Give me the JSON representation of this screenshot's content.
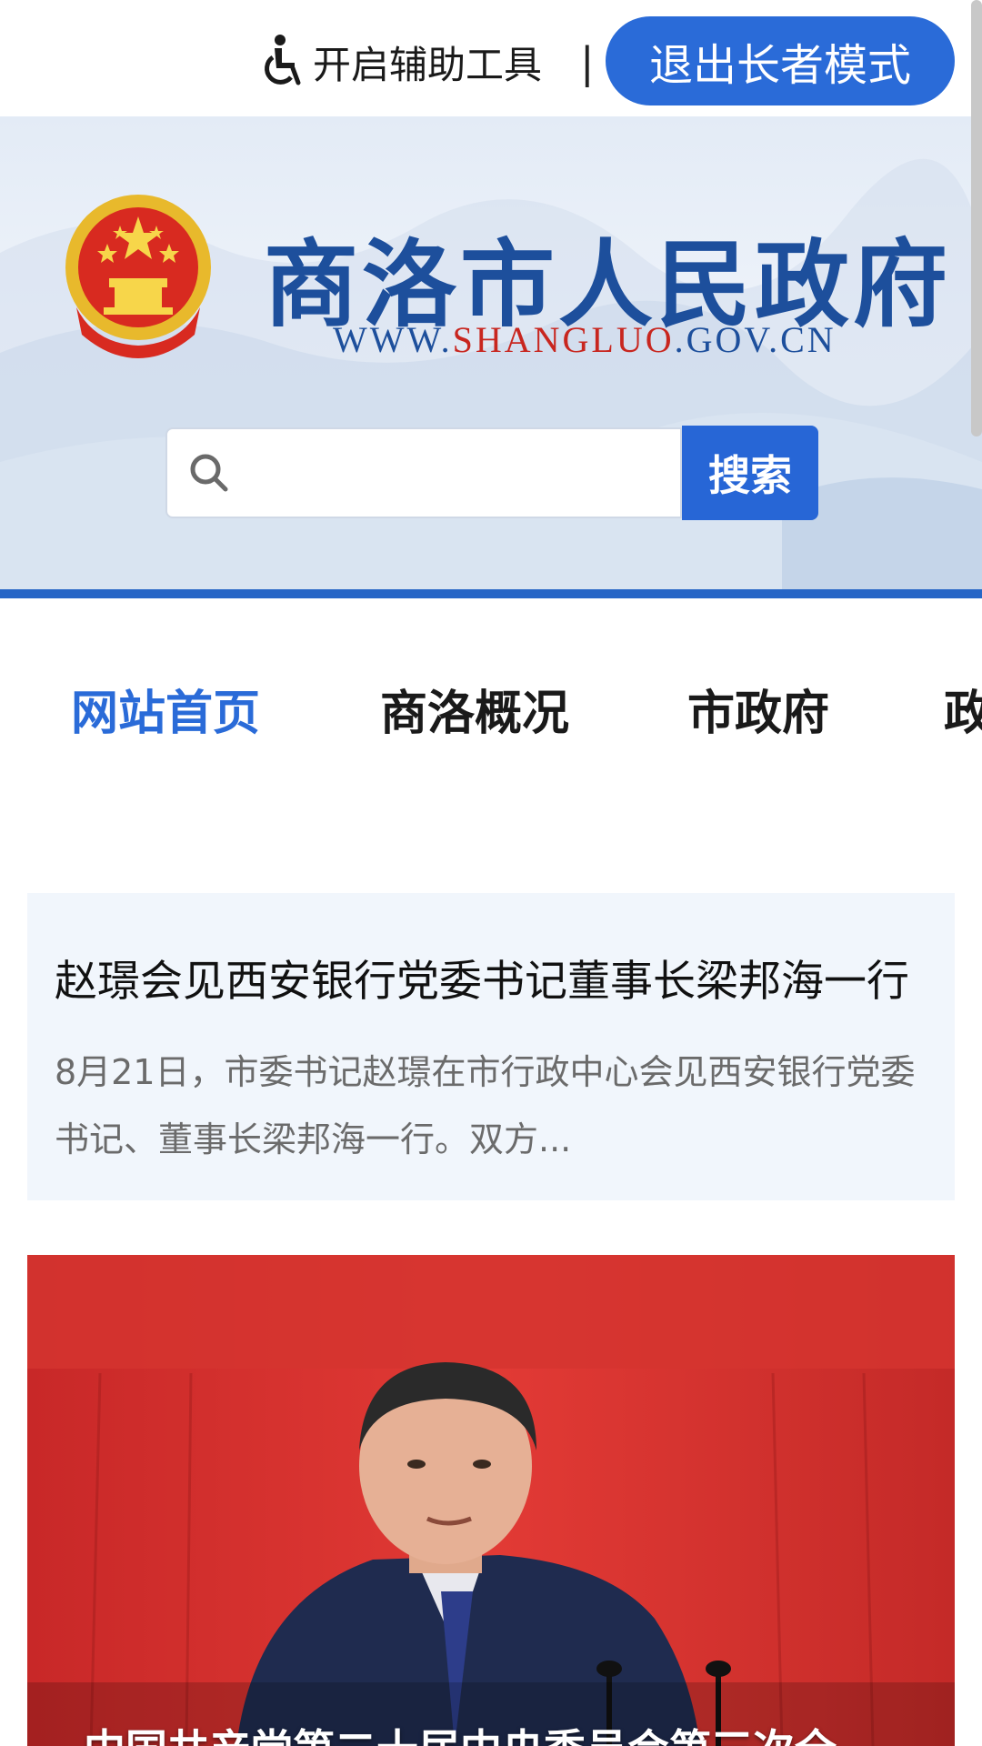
{
  "topbar": {
    "accessibility_icon": "wheelchair-icon",
    "accessibility_label": "开启辅助工具",
    "separator": "|",
    "elder_mode_button": "退出长者模式",
    "accent_color": "#2a6bd8"
  },
  "header": {
    "emblem": "national-emblem",
    "site_title": "商洛市人民政府",
    "site_url_prefix": "WWW.",
    "site_url_highlight": "SHANGLUO",
    "site_url_suffix": ".GOV.CN",
    "title_color": "#1d4f9c",
    "highlight_color": "#c8261f"
  },
  "search": {
    "icon": "search-icon",
    "value": "",
    "placeholder": "",
    "button_label": "搜索"
  },
  "nav": {
    "items": [
      {
        "label": "网站首页",
        "active": true
      },
      {
        "label": "商洛概况",
        "active": false
      },
      {
        "label": "市政府",
        "active": false
      },
      {
        "label": "政",
        "active": false
      }
    ]
  },
  "news": {
    "title": "赵璟会见西安银行党委书记董事长梁邦海一行",
    "summary": "8月21日，市委书记赵璟在市行政中心会见西安银行党委书记、董事长梁邦海一行。双方..."
  },
  "feature": {
    "caption": "中国共产党第二十届中央委员会第三次全"
  }
}
